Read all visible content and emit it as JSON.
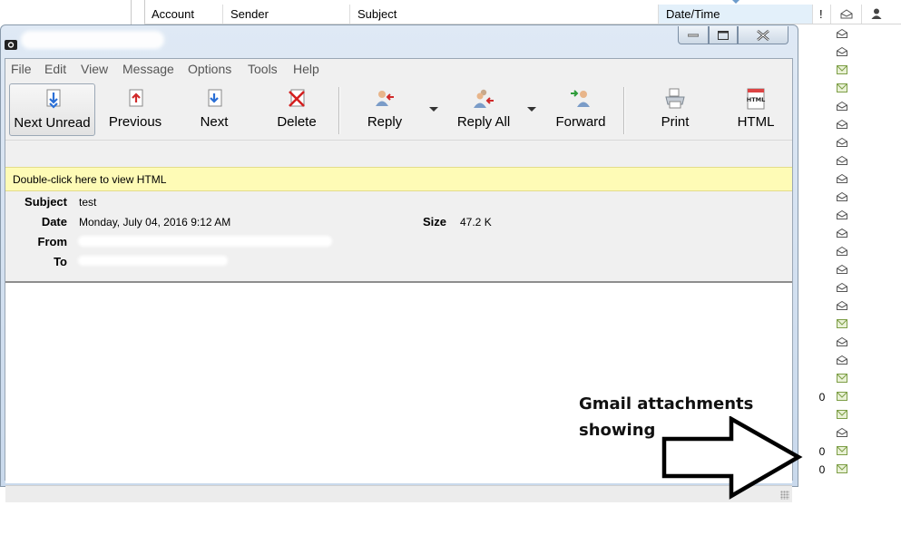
{
  "message_list": {
    "columns": [
      "Account",
      "Sender",
      "Subject",
      "Date/Time",
      "!"
    ],
    "rows": [
      {
        "attachment": false,
        "read": false
      },
      {
        "attachment": false,
        "read": false
      },
      {
        "attachment": false,
        "read": true
      },
      {
        "attachment": false,
        "read": true
      },
      {
        "attachment": false,
        "read": false
      },
      {
        "attachment": false,
        "read": false
      },
      {
        "attachment": false,
        "read": false
      },
      {
        "attachment": false,
        "read": false
      },
      {
        "attachment": false,
        "read": false
      },
      {
        "attachment": false,
        "read": false
      },
      {
        "attachment": false,
        "read": false
      },
      {
        "attachment": false,
        "read": false
      },
      {
        "attachment": false,
        "read": false
      },
      {
        "attachment": false,
        "read": false
      },
      {
        "attachment": false,
        "read": false
      },
      {
        "attachment": false,
        "read": false
      },
      {
        "attachment": false,
        "read": true
      },
      {
        "attachment": false,
        "read": false
      },
      {
        "attachment": false,
        "read": false
      },
      {
        "attachment": false,
        "read": true
      },
      {
        "attachment": true,
        "read": true
      },
      {
        "attachment": false,
        "read": true
      },
      {
        "attachment": false,
        "read": false
      },
      {
        "attachment": true,
        "read": true
      },
      {
        "attachment": true,
        "read": true
      }
    ],
    "clip_glyph": "0"
  },
  "window": {
    "menu": [
      "File",
      "Edit",
      "View",
      "Message",
      "Options",
      "Tools",
      "Help"
    ],
    "toolbar": [
      {
        "label": "Next Unread",
        "icon": "next-unread-icon"
      },
      {
        "label": "Previous",
        "icon": "previous-icon"
      },
      {
        "label": "Next",
        "icon": "next-icon"
      },
      {
        "label": "Delete",
        "icon": "delete-icon"
      },
      {
        "label": "Reply",
        "icon": "reply-icon"
      },
      {
        "label": "Reply All",
        "icon": "reply-all-icon"
      },
      {
        "label": "Forward",
        "icon": "forward-icon"
      },
      {
        "label": "Print",
        "icon": "print-icon"
      },
      {
        "label": "HTML",
        "icon": "html-icon"
      }
    ],
    "html_bar": "Double-click here to view HTML",
    "headers": {
      "subject_label": "Subject",
      "subject": "test",
      "date_label": "Date",
      "date": "Monday, July 04, 2016 9:12 AM",
      "size_label": "Size",
      "size": "47.2 K",
      "from_label": "From",
      "to_label": "To"
    }
  },
  "annotation": "Gmail attachments\nshowing",
  "colors": {
    "html_bar": "#fefbb6",
    "window_frame": "#c9d9ec",
    "envelope_read": "#7d9e46"
  }
}
